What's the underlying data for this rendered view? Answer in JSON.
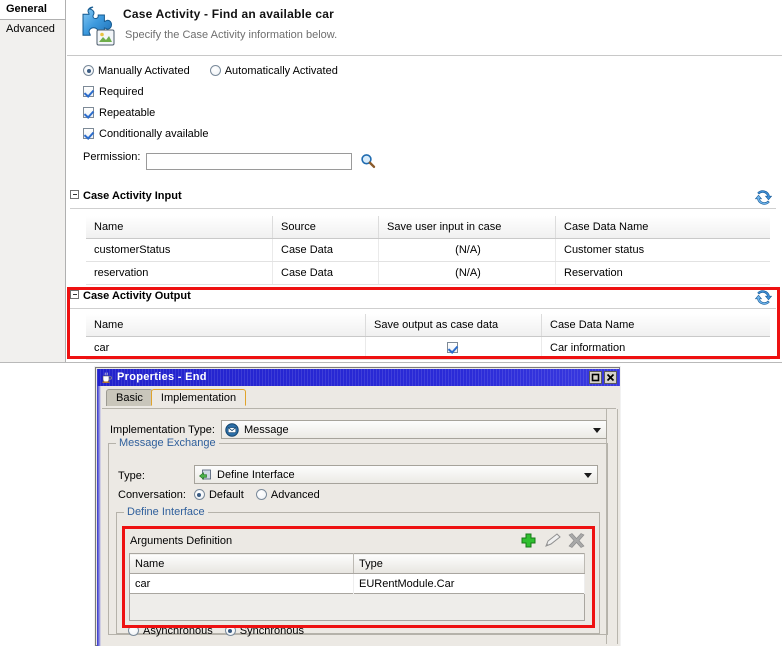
{
  "editor": {
    "tabs": [
      {
        "label": "General",
        "selected": true
      },
      {
        "label": "Advanced",
        "selected": false
      }
    ],
    "header": {
      "icon": "puzzle-piece-icon",
      "title": "Case Activity - Find an available car",
      "subtitle": "Specify the Case Activity information below."
    },
    "activation": {
      "manual_label": "Manually Activated",
      "manual_selected": true,
      "auto_label": "Automatically Activated",
      "auto_selected": false
    },
    "checkboxes": [
      {
        "label": "Required",
        "checked": true
      },
      {
        "label": "Repeatable",
        "checked": true
      },
      {
        "label": "Conditionally available",
        "checked": true
      }
    ],
    "permission": {
      "label": "Permission:",
      "value": "",
      "placeholder": "",
      "search_icon": "magnifier-icon"
    },
    "input_section": {
      "title": "Case Activity Input",
      "expanded": true,
      "refresh_icon": "refresh-icon",
      "columns": [
        "Name",
        "Source",
        "Save user input in case",
        "Case Data Name"
      ],
      "rows": [
        [
          "customerStatus",
          "Case Data",
          "(N/A)",
          "Customer status"
        ],
        [
          "reservation",
          "Case Data",
          "(N/A)",
          "Reservation"
        ]
      ]
    },
    "output_section": {
      "title": "Case Activity Output",
      "expanded": true,
      "refresh_icon": "refresh-icon",
      "highlighted": true,
      "columns": [
        "Name",
        "Save output as case data",
        "Case Data Name"
      ],
      "rows": [
        {
          "name": "car",
          "save_as_case_data": true,
          "case_data_name": "Car information"
        }
      ]
    }
  },
  "dialog": {
    "title": "Properties - End",
    "title_icon": "coffee-cup-icon",
    "window_buttons": {
      "maximize": "maximize-icon",
      "close": "close-icon"
    },
    "tabs": [
      {
        "label": "Basic",
        "active": false
      },
      {
        "label": "Implementation",
        "active": true
      }
    ],
    "implementation_type": {
      "label": "Implementation Type:",
      "value": "Message",
      "icon": "message-envelope-icon"
    },
    "message_exchange": {
      "group_title": "Message Exchange",
      "type_label": "Type:",
      "type_value": "Define Interface",
      "type_icon": "define-interface-icon",
      "conversation_label": "Conversation:",
      "conversation_default": "Default",
      "conversation_default_selected": true,
      "conversation_advanced": "Advanced",
      "conversation_advanced_selected": false
    },
    "define_interface": {
      "group_title": "Define Interface",
      "highlighted": true,
      "arguments": {
        "title": "Arguments Definition",
        "tools": [
          "add-icon",
          "edit-icon",
          "delete-icon"
        ],
        "columns": [
          "Name",
          "Type"
        ],
        "rows": [
          [
            "car",
            "EURentModule.Car"
          ]
        ]
      },
      "sync_options": {
        "asynchronous_label": "Asynchronous",
        "asynchronous_selected": false,
        "synchronous_label": "Synchronous",
        "synchronous_selected": true
      }
    }
  },
  "colors": {
    "highlight": "#ee1111",
    "titlebar": "#2222cc",
    "group_title": "#30609c",
    "active_tab_border": "#e0a32a"
  }
}
